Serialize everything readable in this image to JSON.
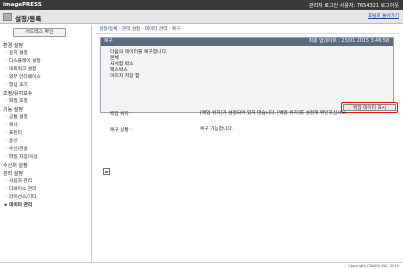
{
  "topbar": {
    "brand": "imagePRESS",
    "user_info": "관리자  로그인 사용자: 7654321  로그아웃"
  },
  "header": {
    "title": "설정/등록",
    "portal_link": "포털로 돌아가기"
  },
  "sidebar": {
    "address_button": "어드레스 확인",
    "items": [
      {
        "type": "group",
        "label": "환경 설정"
      },
      {
        "type": "item",
        "label": "용지 설정"
      },
      {
        "type": "item",
        "label": "디스플레이 설정"
      },
      {
        "type": "item",
        "label": "네트워크 설정"
      },
      {
        "type": "item",
        "label": "외부 인터페이스"
      },
      {
        "type": "item",
        "label": "항상 초기"
      },
      {
        "type": "group",
        "label": "조정/유지보수"
      },
      {
        "type": "item",
        "label": "화질 조정"
      },
      {
        "type": "group",
        "label": "기능 설정"
      },
      {
        "type": "item",
        "label": "공통 설정"
      },
      {
        "type": "item",
        "label": "복사"
      },
      {
        "type": "item",
        "label": "프린터"
      },
      {
        "type": "item",
        "label": "송신"
      },
      {
        "type": "item",
        "label": "수신/전송"
      },
      {
        "type": "item",
        "label": "파일 저장/이용"
      },
      {
        "type": "group",
        "label": "수신처 설정"
      },
      {
        "type": "group",
        "label": "관리 설정"
      },
      {
        "type": "item",
        "label": "사용자 관리"
      },
      {
        "type": "item",
        "label": "디바이스 관리"
      },
      {
        "type": "item",
        "label": "라이선스/기타"
      },
      {
        "type": "item",
        "label": "데이터 관리",
        "active": true
      }
    ]
  },
  "breadcrumb": {
    "parts": [
      "설정/등록",
      "관리 설정",
      "데이터 관리",
      "복구"
    ]
  },
  "panel": {
    "title": "복구",
    "timestamp": "최종 업데이트 : 23/01 2015 3:46:58",
    "lines": [
      "다음의 데이터를 복구합니다.",
      "본체",
      "사서함 박스",
      "팩스박스",
      "이미지 저장 함"
    ],
    "show_button": "백업 데이터 표시"
  },
  "properties": [
    {
      "key": "백업 위치 :",
      "value": "[백업 위치]가 설정되어 있지 않습니다. [백업 위치]를 설정해 확인하십시오."
    },
    {
      "key": "복구 상황 :",
      "value": "복구 가능합니다."
    }
  ],
  "footer": {
    "copyright": "Copyright CANON INC. 2015"
  }
}
